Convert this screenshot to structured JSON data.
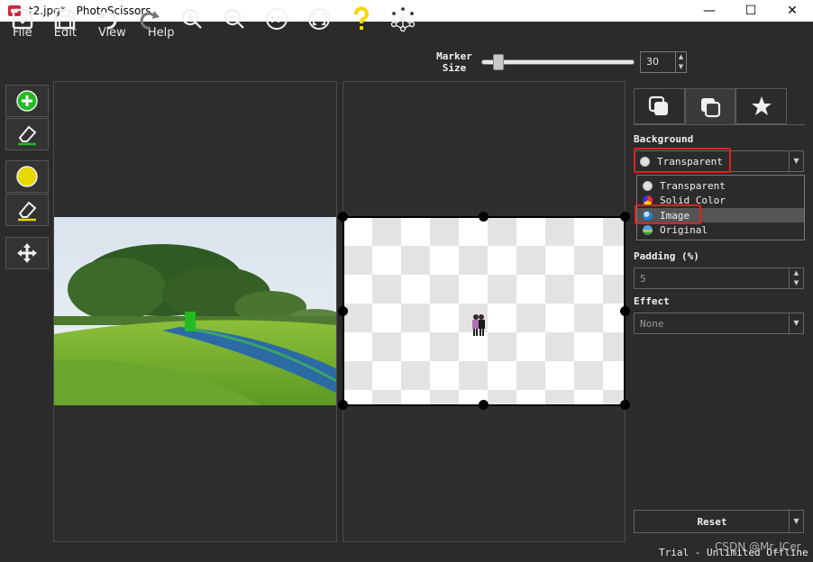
{
  "window": {
    "title": "t2.jpg* - PhotoScissors",
    "minimize": "—",
    "maximize": "☐",
    "close": "✕"
  },
  "menu": [
    "File",
    "Edit",
    "View",
    "Help"
  ],
  "toolbar": {
    "marker_label_line1": "Marker",
    "marker_label_line2": "Size",
    "marker_size": "30",
    "marker_size_fraction": 0.08,
    "icons": [
      "open-icon",
      "save-icon",
      "undo-icon",
      "redo-icon",
      "zoom-in-icon",
      "zoom-out-icon",
      "actual-size-icon",
      "fit-icon",
      "help-icon",
      "network-icon"
    ]
  },
  "left_tools": [
    "add-foreground-marker-icon",
    "erase-foreground-icon",
    "add-background-marker-icon",
    "erase-background-icon",
    "move-icon"
  ],
  "right_panel": {
    "tabs": [
      "foreground-tab-icon",
      "background-tab-icon",
      "effects-tab-icon"
    ],
    "background_label": "Background",
    "background_value": "Transparent",
    "dropdown_options": [
      "Transparent",
      "Solid Color",
      "Image",
      "Original"
    ],
    "highlighted_option": "Image",
    "padding_label": "Padding (%)",
    "padding_value": "5",
    "effect_label": "Effect",
    "effect_value": "None",
    "reset_label": "Reset"
  },
  "status": "Trial - Unlimited Offline",
  "watermark": "CSDN @Mr_ICer",
  "colors": {
    "background": "#2b2b2b",
    "highlight_box": "#e02020",
    "add_marker": "#22bb22",
    "bg_marker": "#e8d800",
    "help": "#f5d800"
  }
}
